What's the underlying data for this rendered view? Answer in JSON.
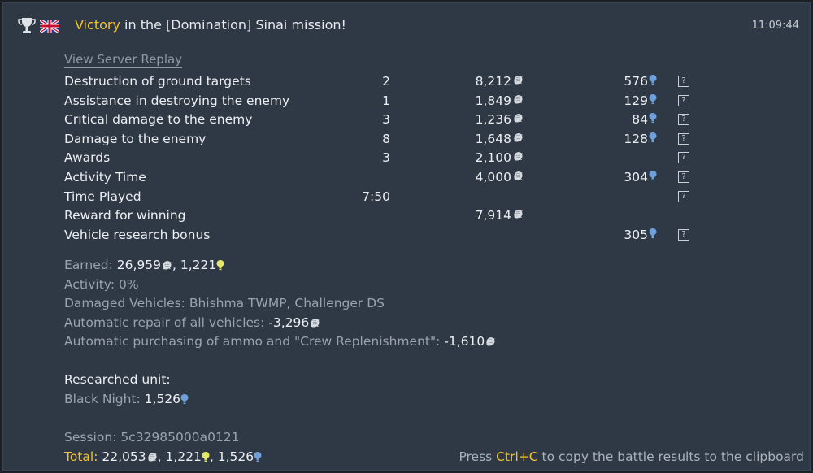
{
  "header": {
    "victory": "Victory",
    "title_rest": " in the [Domination] Sinai mission!",
    "time": "11:09:44"
  },
  "replay_link": "View Server Replay",
  "rows": [
    {
      "label": "Destruction of ground targets",
      "count": "2",
      "sl": "8,212",
      "rp": "576",
      "help": "?"
    },
    {
      "label": "Assistance in destroying the enemy",
      "count": "1",
      "sl": "1,849",
      "rp": "129",
      "help": "?"
    },
    {
      "label": "Critical damage to the enemy",
      "count": "3",
      "sl": "1,236",
      "rp": "84",
      "help": "?"
    },
    {
      "label": "Damage to the enemy",
      "count": "8",
      "sl": "1,648",
      "rp": "128",
      "help": "?"
    },
    {
      "label": "Awards",
      "count": "3",
      "sl": "2,100",
      "rp": "",
      "help": "?"
    },
    {
      "label": "Activity Time",
      "count": "",
      "sl": "4,000",
      "rp": "304",
      "help": "?"
    },
    {
      "label": "Time Played",
      "count": "7:50",
      "sl": "",
      "rp": "",
      "help": "?"
    },
    {
      "label": "Reward for winning",
      "count": "",
      "sl": "7,914",
      "rp": "",
      "help": ""
    },
    {
      "label": "Vehicle research bonus",
      "count": "",
      "sl": "",
      "rp": "305",
      "help": "?"
    }
  ],
  "summary": {
    "earned_label": "Earned:",
    "earned_sl": "26,959",
    "earned_conv": "1,221",
    "activity_label": "Activity:",
    "activity_value": "0%",
    "damaged_label": "Damaged Vehicles:",
    "damaged_value": "Bhishma TWMP, Challenger DS",
    "repair_label": "Automatic repair of all vehicles:",
    "repair_value": "-3,296",
    "ammo_label": "Automatic purchasing of ammo and \"Crew Replenishment\":",
    "ammo_value": "-1,610"
  },
  "research": {
    "heading": "Researched unit:",
    "unit_label": "Black Night:",
    "unit_value": "1,526"
  },
  "session": {
    "label": "Session:",
    "value": "5c32985000a0121"
  },
  "total": {
    "label": "Total:",
    "sl": "22,053",
    "conv": "1,221",
    "rp": "1,526"
  },
  "hint": {
    "pre": "Press ",
    "key": "Ctrl+C",
    "post": " to copy the battle results to the clipboard"
  },
  "colors": {
    "panel": "#2f3946",
    "gold": "#f1c232",
    "rp_blue": "#6f9fd8",
    "conv_yellow": "#e4e86a"
  }
}
